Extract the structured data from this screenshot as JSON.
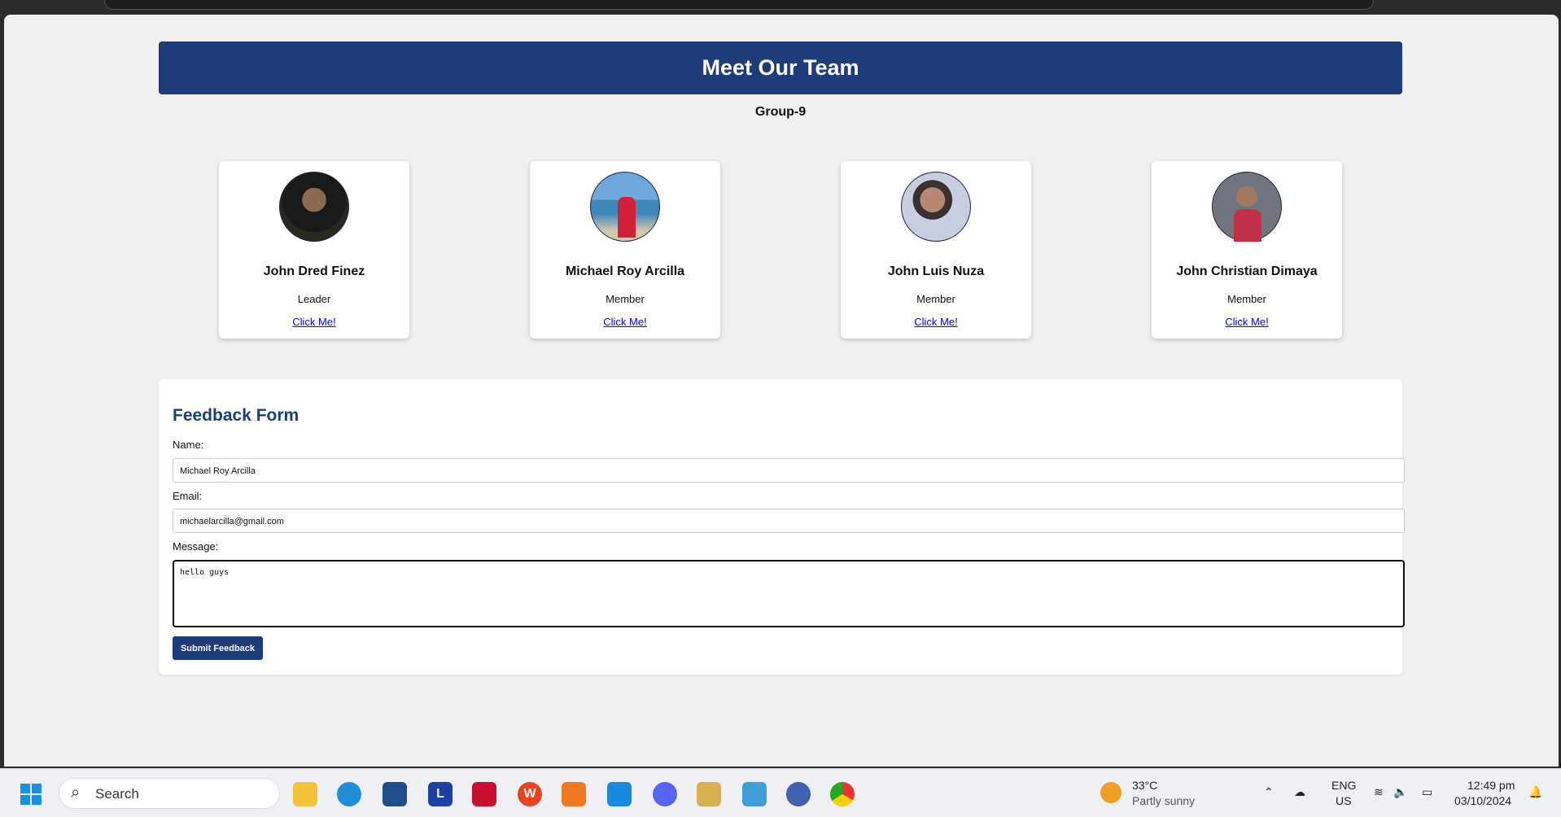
{
  "page": {
    "title": "Meet Our Team",
    "subtitle": "Group-9"
  },
  "team": [
    {
      "name": "John Dred Finez",
      "role": "Leader",
      "link": "Click Me!"
    },
    {
      "name": "Michael Roy Arcilla",
      "role": "Member",
      "link": "Click Me!"
    },
    {
      "name": "John Luis Nuza",
      "role": "Member",
      "link": "Click Me!"
    },
    {
      "name": "John Christian Dimaya",
      "role": "Member",
      "link": "Click Me!"
    }
  ],
  "form": {
    "title": "Feedback Form",
    "name_label": "Name:",
    "name_value": "Michael Roy Arcilla",
    "email_label": "Email:",
    "email_value": "michaelarcilla@gmail.com",
    "message_label": "Message:",
    "message_value": "hello guys",
    "submit": "Submit Feedback"
  },
  "taskbar": {
    "search": "Search",
    "weather_temp": "33°C",
    "weather_desc": "Partly sunny",
    "lang": "ENG",
    "region": "US",
    "time": "12:49 pm",
    "date": "03/10/2024",
    "apps": [
      "file-explorer",
      "edge",
      "store",
      "l-app",
      "mcafee",
      "wps",
      "xampp",
      "vscode",
      "discord",
      "archive",
      "notepad",
      "app",
      "chrome"
    ]
  },
  "colors": {
    "accent": "#1c3d7a",
    "link": "#0000ee"
  }
}
